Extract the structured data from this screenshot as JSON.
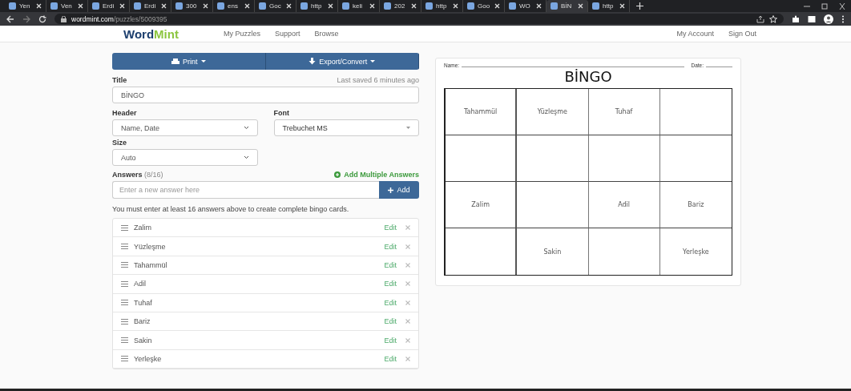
{
  "browser": {
    "tabs": [
      {
        "label": "Yen",
        "selected": false
      },
      {
        "label": "Ven",
        "selected": false
      },
      {
        "label": "Erdi",
        "selected": false
      },
      {
        "label": "Erdi",
        "selected": false
      },
      {
        "label": "300",
        "selected": false
      },
      {
        "label": "ens",
        "selected": false
      },
      {
        "label": "Goc",
        "selected": false
      },
      {
        "label": "http",
        "selected": false
      },
      {
        "label": "keli",
        "selected": false
      },
      {
        "label": "202",
        "selected": false
      },
      {
        "label": "http",
        "selected": false
      },
      {
        "label": "Goo",
        "selected": false
      },
      {
        "label": "WO",
        "selected": false
      },
      {
        "label": "BİN",
        "selected": true
      },
      {
        "label": "http",
        "selected": false
      }
    ],
    "url_host": "wordmint.com",
    "url_path": "/puzzles/5009395"
  },
  "site_nav": {
    "logo_a": "Word",
    "logo_b": "Mint",
    "links": [
      "My Puzzles",
      "Support",
      "Browse"
    ],
    "account_links": [
      "My Account",
      "Sign Out"
    ]
  },
  "editor": {
    "print_button": "Print",
    "export_button": "Export/Convert",
    "title_label": "Title",
    "saved_note": "Last saved 6 minutes ago",
    "title_value": "BİNGO",
    "header_label": "Header",
    "header_value": "Name, Date",
    "font_label": "Font",
    "font_value": "Trebuchet MS",
    "size_label": "Size",
    "size_value": "Auto",
    "answers_label": "Answers",
    "answers_count": "(8/16)",
    "add_multiple": "Add Multiple Answers",
    "answer_placeholder": "Enter a new answer here",
    "add_button": "Add",
    "notice": "You must enter at least 16 answers above to create complete bingo cards.",
    "answers": [
      {
        "text": "Zalim",
        "edit": "Edit"
      },
      {
        "text": "Yüzleşme",
        "edit": "Edit"
      },
      {
        "text": "Tahammül",
        "edit": "Edit"
      },
      {
        "text": "Adil",
        "edit": "Edit"
      },
      {
        "text": "Tuhaf",
        "edit": "Edit"
      },
      {
        "text": "Bariz",
        "edit": "Edit"
      },
      {
        "text": "Sakin",
        "edit": "Edit"
      },
      {
        "text": "Yerleşke",
        "edit": "Edit"
      }
    ]
  },
  "preview": {
    "name_label": "Name:",
    "date_label": "Date:",
    "title": "BİNGO",
    "grid": [
      [
        {
          "kind": "word",
          "text": "Tahammül"
        },
        {
          "kind": "word",
          "text": "Yüzleşme"
        },
        {
          "kind": "word",
          "text": "Tuhaf"
        },
        {
          "kind": "blank"
        }
      ],
      [
        {
          "kind": "blank"
        },
        {
          "kind": "blank"
        },
        {
          "kind": "blank"
        },
        {
          "kind": "blank"
        }
      ],
      [
        {
          "kind": "word",
          "text": "Zalim"
        },
        {
          "kind": "blank"
        },
        {
          "kind": "word",
          "text": "Adil"
        },
        {
          "kind": "word",
          "text": "Bariz"
        }
      ],
      [
        {
          "kind": "blank"
        },
        {
          "kind": "word",
          "text": "Sakin"
        },
        {
          "kind": "blank"
        },
        {
          "kind": "word",
          "text": "Yerleşke"
        }
      ]
    ]
  }
}
